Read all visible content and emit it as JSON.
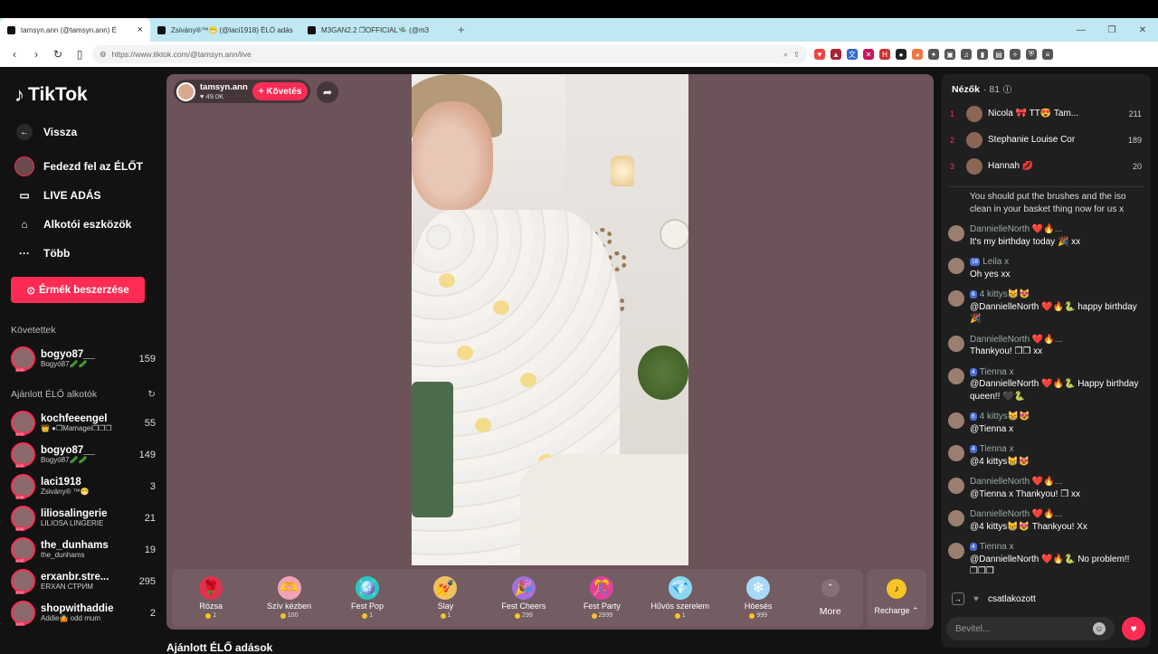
{
  "browser": {
    "tabs": [
      {
        "title": "tamsyn.ann (@tamsyn.ann) É"
      },
      {
        "title": "Zsivány®™😁 (@laci1918) ÉLŐ adás"
      },
      {
        "title": "M3GAN2.2 ❒OFFICIAL🛸 (@m3"
      }
    ],
    "url": "https://www.tiktok.com/@tamsyn.ann/live"
  },
  "sidebar": {
    "logo": "TikTok",
    "back": "Vissza",
    "nav": [
      {
        "label": "Fedezd fel az ÉLŐT",
        "icon": "avatar-icon"
      },
      {
        "label": "LIVE ADÁS",
        "icon": "video-icon"
      },
      {
        "label": "Alkotói eszközök",
        "icon": "lightbulb-icon"
      },
      {
        "label": "Több",
        "icon": "more-icon"
      }
    ],
    "coins_button": "Érmék beszerzése",
    "following_title": "Követettek",
    "following": [
      {
        "name": "bogyo87__",
        "sub": "Bogyó87🥒🥒",
        "count": "159"
      }
    ],
    "recommended_title": "Ajánlott ÉLŐ alkotók",
    "recommended": [
      {
        "name": "kochfeeengel",
        "sub": "👑 ●❒Mamagei❒❒❒",
        "count": "55"
      },
      {
        "name": "bogyo87__",
        "sub": "Bogyó87🥒🥒",
        "count": "149"
      },
      {
        "name": "laci1918",
        "sub": "Zsivány® ™😁",
        "count": "3"
      },
      {
        "name": "liliosalingerie",
        "sub": "LILIOSA LINGERIE",
        "count": "21"
      },
      {
        "name": "the_dunhams",
        "sub": "the_dunhams",
        "count": "19"
      },
      {
        "name": "erxanbr.stre...",
        "sub": "ЕRXAN СТРИМ",
        "count": "295"
      },
      {
        "name": "shopwithaddie",
        "sub": "Addie🤷 odd mum",
        "count": "2"
      }
    ]
  },
  "live": {
    "host_name": "tamsyn.ann",
    "host_likes": "♥ 49.0K",
    "follow_label": "+ Követés",
    "gifts": [
      {
        "name": "Rózsa",
        "price": "1",
        "icon": "🌹",
        "bg": "#e0324f"
      },
      {
        "name": "Szív kézben",
        "price": "100",
        "icon": "🫶",
        "bg": "#f0a2b8"
      },
      {
        "name": "Fest Pop",
        "price": "1",
        "icon": "🪩",
        "bg": "#2ac8c0"
      },
      {
        "name": "Slay",
        "price": "1",
        "icon": "💅",
        "bg": "#f0c060"
      },
      {
        "name": "Fest Cheers",
        "price": "299",
        "icon": "🎉",
        "bg": "#a070e0"
      },
      {
        "name": "Fest Party",
        "price": "2999",
        "icon": "🎊",
        "bg": "#e040a0"
      },
      {
        "name": "Hűvös szerelem",
        "price": "1",
        "icon": "💎",
        "bg": "#8ad8f0"
      },
      {
        "name": "Hóesés",
        "price": "999",
        "icon": "❄",
        "bg": "#a8d8f8"
      }
    ],
    "more_label": "More",
    "recharge_label": "Recharge ⌃",
    "recommended_heading": "Ajánlott ÉLŐ adások"
  },
  "chat": {
    "viewers_title": "Nézők",
    "viewers_count": "· 81",
    "top_viewers": [
      {
        "rank": "1",
        "name": "Nicola 🎀 TT😍 Tam...",
        "count": "211"
      },
      {
        "rank": "2",
        "name": "Stephanie Louise Cor",
        "count": "189"
      },
      {
        "rank": "3",
        "name": "Hannah 💋",
        "count": "20"
      }
    ],
    "messages": [
      {
        "user": "",
        "badge": "",
        "text": "You should put the brushes and the iso clean in your basket thing now for us x"
      },
      {
        "user": "DannielleNorth ❤️🔥...",
        "badge": "",
        "text": "It's my birthday today 🎉 xx"
      },
      {
        "user": "Leila x",
        "badge": "16",
        "text": "Oh yes xx"
      },
      {
        "user": "4 kittys😸😻",
        "badge": "6",
        "text": "@DannielleNorth ❤️🔥🐍 happy birthday 🎉"
      },
      {
        "user": "DannielleNorth ❤️🔥...",
        "badge": "",
        "text": "Thankyou! ❒❒ xx"
      },
      {
        "user": "Tienna x",
        "badge": "4",
        "text": "@DannielleNorth ❤️🔥🐍 Happy birthday queen!! 🖤🐍"
      },
      {
        "user": "4 kittys😸😻",
        "badge": "6",
        "text": "@Tienna x"
      },
      {
        "user": "Tienna x",
        "badge": "4",
        "text": "@4 kittys😸😻"
      },
      {
        "user": "DannielleNorth ❤️🔥...",
        "badge": "",
        "text": "@Tienna x Thankyou! ❒ xx"
      },
      {
        "user": "DannielleNorth ❤️🔥...",
        "badge": "",
        "text": "@4 kittys😸😻 Thankyou! Xx"
      },
      {
        "user": "Tienna x",
        "badge": "4",
        "text": "@DannielleNorth ❤️🔥🐍 No problem!!❒❒❒"
      }
    ],
    "joined_text": "csatlakozott",
    "input_placeholder": "Bevitel..."
  }
}
